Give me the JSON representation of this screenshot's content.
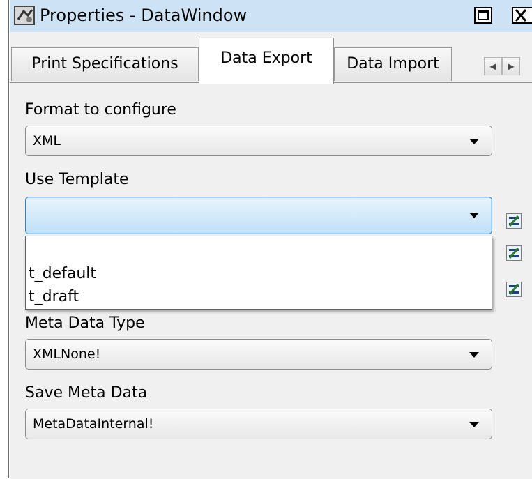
{
  "window": {
    "title": "Properties - DataWindow"
  },
  "tabs": [
    {
      "label": "Print Specifications"
    },
    {
      "label": "Data Export"
    },
    {
      "label": "Data Import"
    }
  ],
  "form": {
    "format_label": "Format to configure",
    "format_value": "XML",
    "template_label": "Use Template",
    "template_value": "",
    "template_options": [
      "",
      "t_default",
      "t_draft"
    ],
    "meta_type_label": "Meta Data Type",
    "meta_type_value": "XMLNone!",
    "save_meta_label": "Save Meta Data",
    "save_meta_value": "MetaDataInternal!"
  },
  "colors": {
    "focus_border": "#3c7fb1",
    "focus_fill": "#bfe0f6",
    "panel_bg": "#f0f0f0",
    "title_bg": "#cde2f4"
  },
  "icons": {
    "title": "properties-window-icon",
    "edit_buttons": "expression-edit-icon"
  }
}
